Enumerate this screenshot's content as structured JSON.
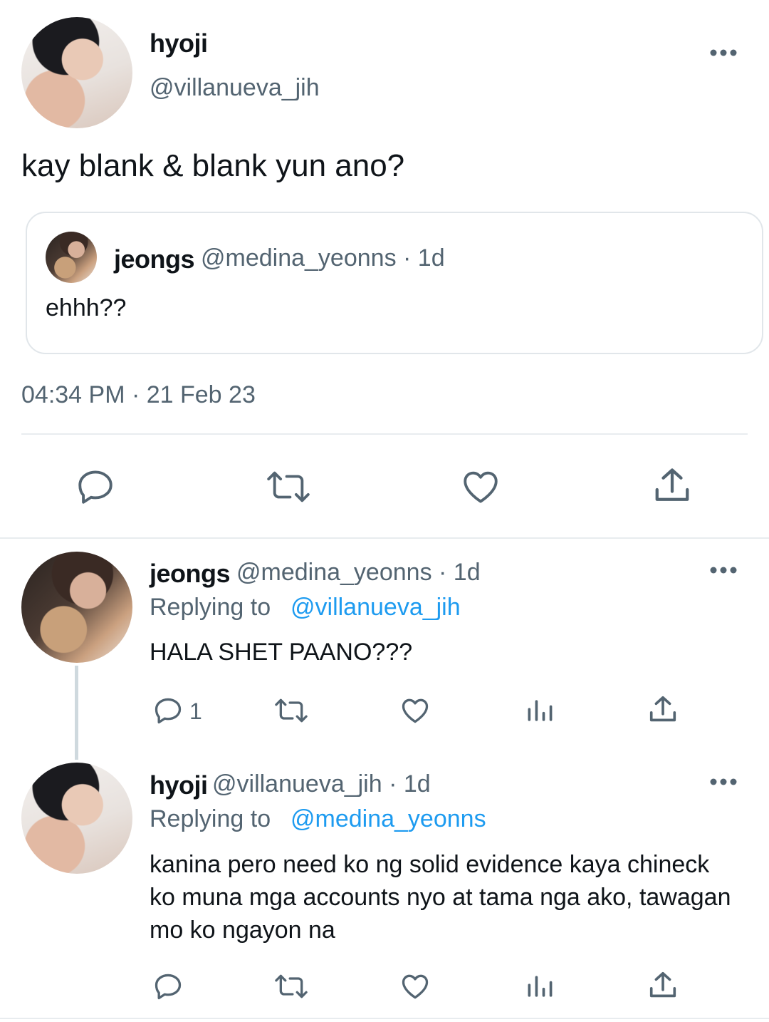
{
  "main_tweet": {
    "display_name": "hyoji",
    "handle": "@villanueva_jih",
    "text": "kay blank & blank yun ano?",
    "timestamp": "04:34 PM · 21 Feb 23",
    "quoted": {
      "display_name": "jeongs",
      "handle_time": "@medina_yeonns · 1d",
      "text": "ehhh??"
    }
  },
  "replies": [
    {
      "display_name": "jeongs",
      "handle_time": "@medina_yeonns · 1d",
      "replying_prefix": "Replying to",
      "replying_to": "@villanueva_jih",
      "text": "HALA SHET PAANO???",
      "reply_count": "1"
    },
    {
      "display_name": "hyoji",
      "handle_time": "@villanueva_jih · 1d",
      "replying_prefix": "Replying to",
      "replying_to": "@medina_yeonns",
      "text": "kanina pero need ko ng solid evidence kaya chineck ko muna mga accounts nyo at tama nga ako, tawagan mo ko ngayon na"
    }
  ],
  "icons": {
    "more": "more-dots-icon",
    "reply": "reply-bubble-icon",
    "retweet": "retweet-icon",
    "like": "heart-icon",
    "views": "analytics-bars-icon",
    "share": "share-upload-icon"
  },
  "colors": {
    "text": "#0f1419",
    "muted": "#536471",
    "link": "#1d9bf0",
    "divider": "#e8ecef"
  }
}
